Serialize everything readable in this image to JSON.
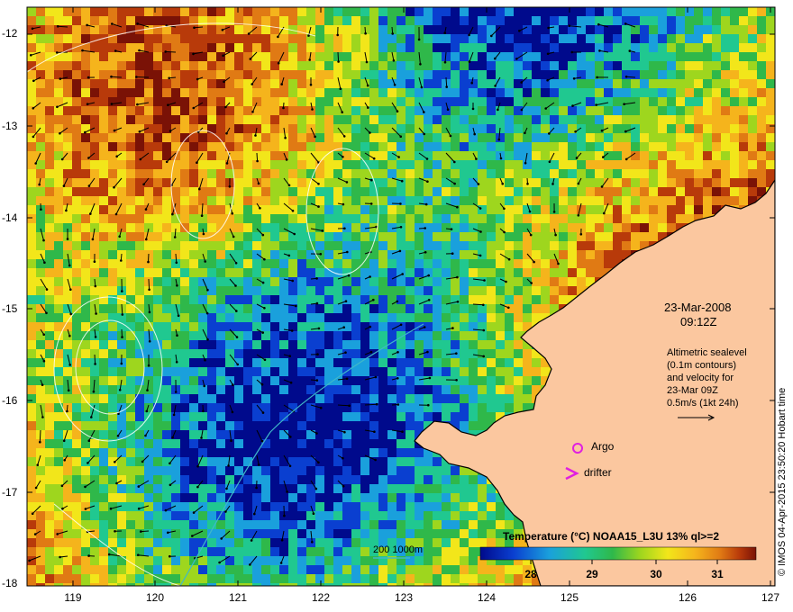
{
  "map": {
    "lat_labels": [
      "-12",
      "-13",
      "-14",
      "-15",
      "-16",
      "-17",
      "-18"
    ],
    "lon_labels": [
      "119",
      "120",
      "121",
      "122",
      "123",
      "124",
      "125",
      "126",
      "127"
    ],
    "land_color": "#fbc79f",
    "ocean_palette": [
      "#000a8c",
      "#0a3fd0",
      "#1aa0dc",
      "#20c890",
      "#2fb84a",
      "#9ed61e",
      "#f2e61a",
      "#f5b41c",
      "#e07a14",
      "#b83a0a",
      "#7a1206"
    ]
  },
  "annotation": {
    "date": "23-Mar-2008",
    "time": "09:12Z",
    "altimetry_lines": [
      "Altimetric sealevel",
      "(0.1m contours)",
      "and velocity for",
      "23-Mar 09Z",
      "0.5m/s (1kt 24h)"
    ],
    "argo_label": "Argo",
    "drifter_label": "drifter",
    "argo_color": "#e020e0",
    "drifter_color": "#e020e0"
  },
  "scale": {
    "label": "200  1000m",
    "color": "#3fb8c8"
  },
  "colorbar": {
    "title": "Temperature (°C) NOAA15_L3U 13% ql>=2",
    "ticks": [
      "28",
      "29",
      "30",
      "31"
    ]
  },
  "credit": "© IMOS 04-Apr-2015 23:50:20 Hobart time"
}
